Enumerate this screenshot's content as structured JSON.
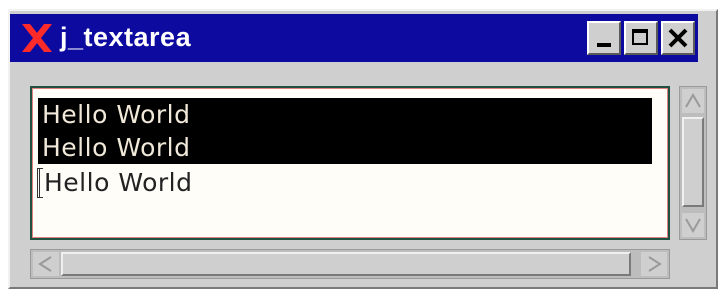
{
  "window": {
    "title": "j_textarea",
    "logo_icon": "x-logo-icon",
    "controls": {
      "minimize_icon": "minimize-icon",
      "maximize_icon": "maximize-icon",
      "close_icon": "close-icon"
    }
  },
  "textarea": {
    "lines": [
      {
        "text": "Hello World",
        "selected": true
      },
      {
        "text": "Hello World",
        "selected": true
      },
      {
        "text": "Hello World",
        "selected": false
      }
    ]
  },
  "colors": {
    "titlebar": "#0d0aa0",
    "logo": "#ff2a2a",
    "selection_bg": "#000000",
    "selection_fg": "#f0e8d8"
  }
}
